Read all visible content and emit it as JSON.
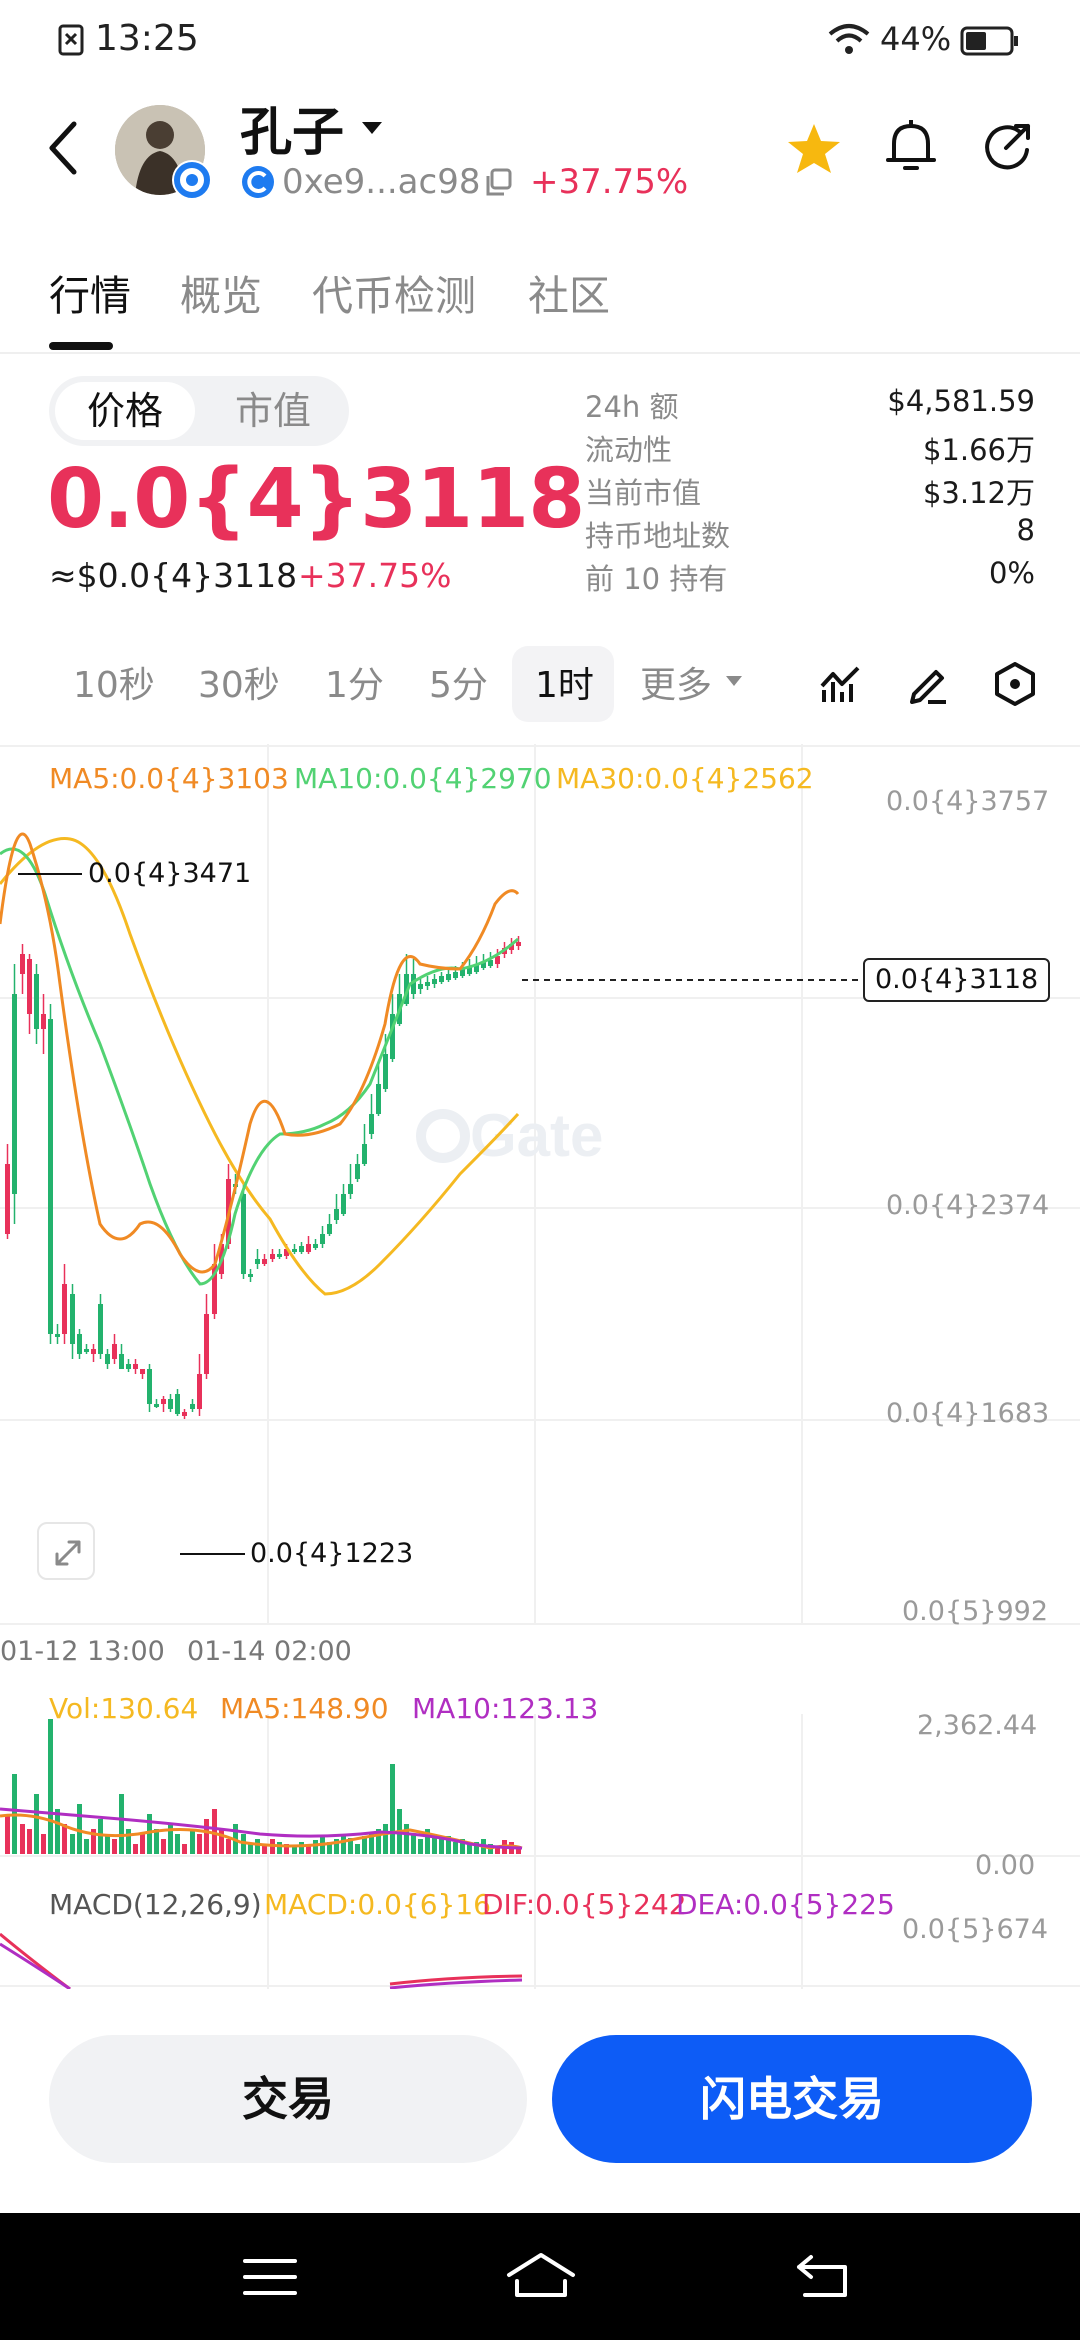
{
  "status_bar": {
    "time": "13:25",
    "battery": "44%"
  },
  "header": {
    "token_name": "孔子",
    "address": "0xe9...ac98",
    "change": "+37.75%"
  },
  "tabs": [
    {
      "label": "行情"
    },
    {
      "label": "概览"
    },
    {
      "label": "代币检测"
    },
    {
      "label": "社区"
    }
  ],
  "price_panel": {
    "toggle": [
      "价格",
      "市值"
    ],
    "price": "0.0{4}3118",
    "usd_price": "≈$0.0{4}3118",
    "usd_change": "+37.75%"
  },
  "stats": [
    {
      "key": "24h  额",
      "value": "$4,581.59"
    },
    {
      "key": "流动性",
      "value": "$1.66万"
    },
    {
      "key": "当前市值",
      "value": "$3.12万"
    },
    {
      "key": "持币地址数",
      "value": "8"
    },
    {
      "key": "前 10 持有",
      "value": "0%"
    }
  ],
  "intervals": {
    "items": [
      "10秒",
      "30秒",
      "1分",
      "5分",
      "1时"
    ],
    "more": "更多",
    "active": "1时"
  },
  "chart": {
    "ma5": "MA5:0.0{4}3103",
    "ma10": "MA10:0.0{4}2970",
    "ma30": "MA30:0.0{4}2562",
    "y_labels": [
      "0.0{4}3757",
      "0.0{4}2374",
      "0.0{4}1683",
      "0.0{5}992"
    ],
    "current_price_tag": "0.0{4}3118",
    "high_label": "0.0{4}3471",
    "low_label": "0.0{4}1223",
    "x_labels": [
      "01-12 13:00",
      "01-14 02:00"
    ],
    "watermark": "Gate",
    "vol": {
      "vol": "Vol:130.64",
      "ma5": "MA5:148.90",
      "ma10": "MA10:123.13",
      "top": "2,362.44",
      "bottom": "0.00"
    },
    "macd": {
      "params": "MACD(12,26,9)",
      "macd": "MACD:0.0{6}16",
      "dif": "DIF:0.0{5}242",
      "dea": "DEA:0.0{5}225",
      "top": "0.0{5}674"
    },
    "colors": {
      "up": "#e8315a",
      "down": "#23b26d",
      "ma5": "#f08a24",
      "ma10": "#52d273",
      "ma30": "#f5b921",
      "vol_ma10": "#b02ec2"
    }
  },
  "buttons": {
    "trade": "交易",
    "flash": "闪电交易"
  }
}
